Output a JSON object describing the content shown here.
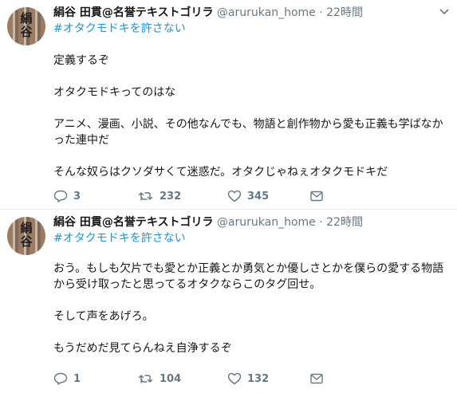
{
  "tweets": [
    {
      "author_name": "絹谷 田貫@名誉テキストゴリラ",
      "handle": "@arurukan_home",
      "separator": "·",
      "time": "22時間",
      "hashtag": "#オタクモドキを許さない",
      "paragraphs": [
        "定義するぞ",
        "オタクモドキってのはな",
        "アニメ、漫画、小説、その他なんでも、物語と創作物から愛も正義も学ばなかった連中だ",
        "そんな奴らはクソダサくて迷惑だ。オタクじゃねぇオタクモドキだ"
      ],
      "reply_count": "3",
      "retweet_count": "232",
      "like_count": "345"
    },
    {
      "author_name": "絹谷 田貫@名誉テキストゴリラ",
      "handle": "@arurukan_home",
      "separator": "·",
      "time": "22時間",
      "hashtag": "#オタクモドキを許さない",
      "paragraphs": [
        "おう。もしも欠片でも愛とか正義とか勇気とか優しさとかを僕らの愛する物語から受け取ったと思ってるオタクならこのタグ回せ。",
        "そして声をあげろ。",
        "もうだめだ見てらんねえ自浄するぞ"
      ],
      "reply_count": "1",
      "retweet_count": "104",
      "like_count": "132"
    }
  ],
  "avatar_text": "絹\n谷",
  "icons": {
    "reply": "reply-icon",
    "retweet": "retweet-icon",
    "like": "heart-icon",
    "dm": "envelope-icon",
    "more": "chevron-down-icon"
  },
  "colors": {
    "hashtag": "#1b95e0",
    "secondary_text": "#657786",
    "divider": "#e6ecf0"
  }
}
